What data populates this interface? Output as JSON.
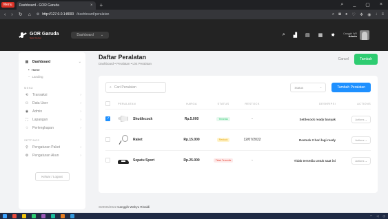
{
  "browser": {
    "menu_label": "Menu",
    "tab_title": "Dashboard - GOR Garuda",
    "url_host": "http://127.0.0.1:8000",
    "url_path": "/dashboard/peralatan"
  },
  "header": {
    "brand": "GOR Garuda",
    "brand_sub": "Sport Center",
    "nav_label": "Dashboard",
    "user_name": "Canggih WR",
    "user_role": "Admin"
  },
  "sidebar": {
    "dashboard": "Dashboard",
    "home": "Home",
    "landing": "Landing",
    "menu_heading": "MENU",
    "items": [
      "Transaksi",
      "Data User",
      "Admin",
      "Lapangan",
      "Perlengkapan"
    ],
    "settings_heading": "SETTINGS",
    "settings": [
      "Pengaturan Paket",
      "Pengaturan Akun"
    ],
    "logout": "Keluar / Logout"
  },
  "page": {
    "title": "Daftar Peralatan",
    "breadcrumb": "Dashboard • Peralatan • List Peralatan",
    "cancel": "Cancel",
    "add": "Tambah"
  },
  "toolbar": {
    "search_placeholder": "Cari Peralatan",
    "status_label": "Status",
    "add_button": "Tambah Peralatan"
  },
  "table": {
    "headers": [
      "PERALATAN",
      "HARGA",
      "STATUS",
      "RESTOCK",
      "DESKRIPSI",
      "ACTIONS"
    ],
    "rows": [
      {
        "name": "Shuttlecock",
        "price": "Rp.5.000",
        "status": "Tersedia",
        "restock": "-",
        "desc": "Settlecock ready banyak",
        "action": "Actions"
      },
      {
        "name": "Raket",
        "price": "Rp.15.000",
        "status": "Restock",
        "restock": "12/07/2022",
        "desc": "Restock 2 hari lagi ready",
        "action": "Actions"
      },
      {
        "name": "Sepatu Sport",
        "price": "Rp.25.000",
        "status": "Tidak Tersedia",
        "restock": "-",
        "desc": "Tidak tersedia untuk saat ini",
        "action": "Actions"
      }
    ]
  },
  "footer": {
    "code": "SMK05/2022",
    "author": "Canggih Wahyu Rinaldi"
  },
  "colors": {
    "primary": "#1e90ff",
    "success": "#2ecc71",
    "header_bg": "#232323"
  }
}
